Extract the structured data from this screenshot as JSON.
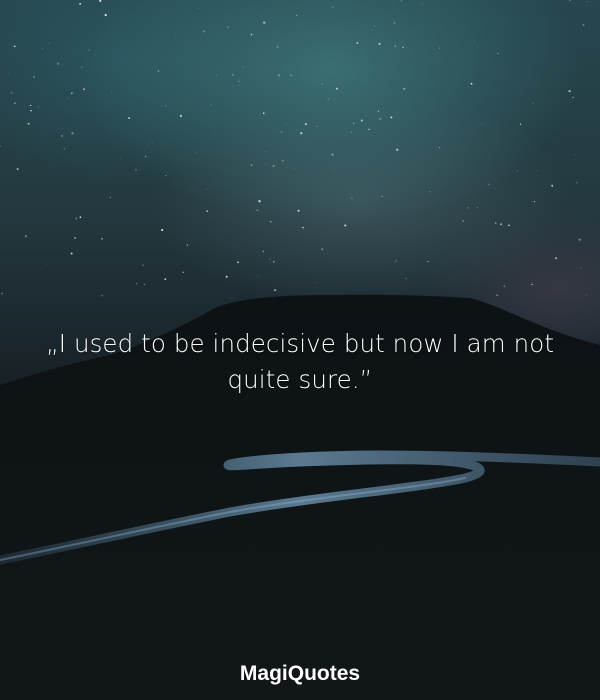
{
  "quote": {
    "text": "„I used to be indecisive but now I am not quite sure.”"
  },
  "brand": {
    "name": "MagiQuotes"
  },
  "colors": {
    "sky_top": "#26474f",
    "sky_glow": "#3e767a",
    "ground": "#101619",
    "road": "#5b7f99",
    "text": "#ffffff"
  }
}
